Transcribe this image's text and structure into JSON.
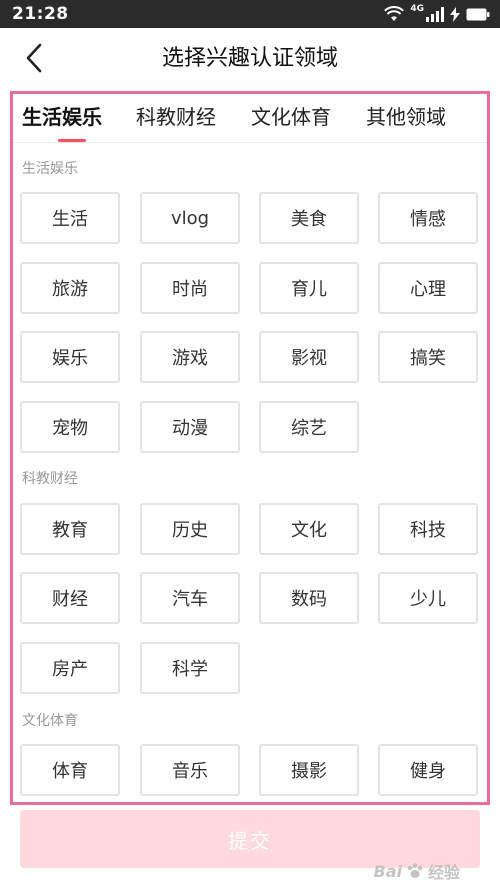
{
  "status_bar": {
    "time": "21:28",
    "network_label": "4G"
  },
  "header": {
    "title": "选择兴趣认证领域",
    "back_icon": "chevron-left-icon"
  },
  "tabs": [
    {
      "label": "生活娱乐",
      "active": true
    },
    {
      "label": "科教财经",
      "active": false
    },
    {
      "label": "文化体育",
      "active": false
    },
    {
      "label": "其他领域",
      "active": false
    }
  ],
  "sections": [
    {
      "title": "生活娱乐",
      "items": [
        "生活",
        "vlog",
        "美食",
        "情感",
        "旅游",
        "时尚",
        "育儿",
        "心理",
        "娱乐",
        "游戏",
        "影视",
        "搞笑",
        "宠物",
        "动漫",
        "综艺"
      ]
    },
    {
      "title": "科教财经",
      "items": [
        "教育",
        "历史",
        "文化",
        "科技",
        "财经",
        "汽车",
        "数码",
        "少儿",
        "房产",
        "科学"
      ]
    },
    {
      "title": "文化体育",
      "items": [
        "体育",
        "音乐",
        "摄影",
        "健身"
      ]
    }
  ],
  "submit_label": "提交",
  "watermark": {
    "brand": "Bai",
    "suffix": "经验"
  },
  "colors": {
    "accent": "#ff4d5e",
    "frame": "#ea6d97",
    "submit_disabled": "#ffd9dd"
  }
}
